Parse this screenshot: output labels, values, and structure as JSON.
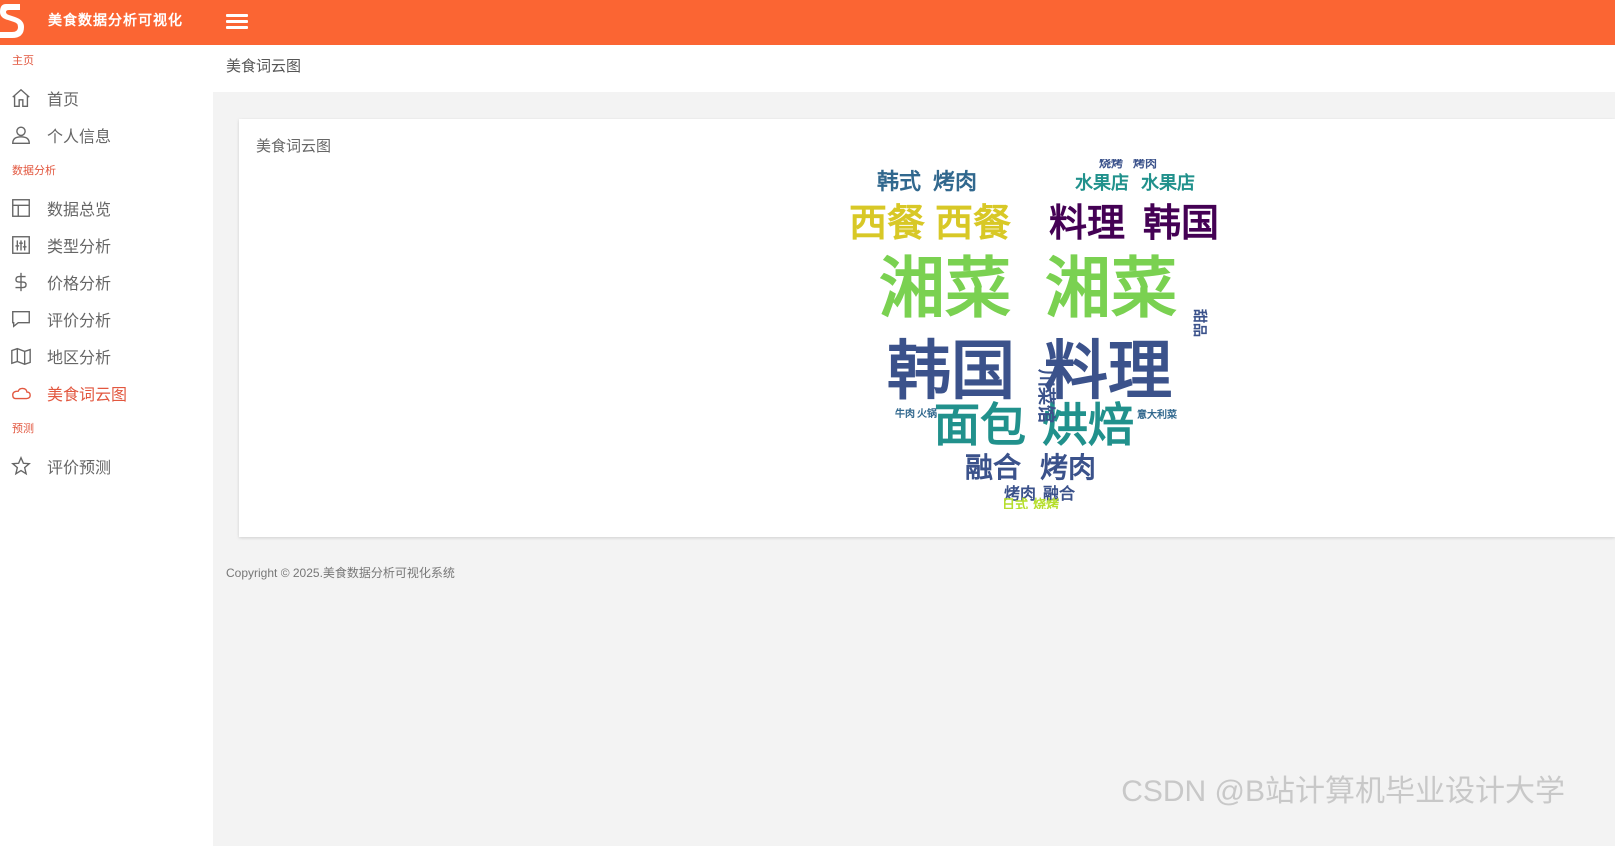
{
  "app": {
    "brand": "美食数据分析可视化",
    "accent": "#fb6533"
  },
  "sidebar": {
    "sections": {
      "main": "主页",
      "analysis": "数据分析",
      "predict": "预测"
    },
    "items": [
      {
        "label": "首页",
        "icon": "home-icon"
      },
      {
        "label": "个人信息",
        "icon": "user-icon"
      },
      {
        "label": "数据总览",
        "icon": "layout-icon"
      },
      {
        "label": "类型分析",
        "icon": "sliders-icon"
      },
      {
        "label": "价格分析",
        "icon": "dollar-icon"
      },
      {
        "label": "评价分析",
        "icon": "message-icon"
      },
      {
        "label": "地区分析",
        "icon": "map-icon"
      },
      {
        "label": "美食词云图",
        "icon": "cloud-icon",
        "active": true
      },
      {
        "label": "评价预测",
        "icon": "star-icon"
      }
    ]
  },
  "page": {
    "title": "美食词云图"
  },
  "card": {
    "title": "美食词云图"
  },
  "wordcloud": {
    "words": [
      "湘菜",
      "湘菜",
      "韩国",
      "料理",
      "面包",
      "烘焙",
      "料理",
      "韩国",
      "西餐",
      "西餐",
      "韩式",
      "烤肉",
      "水果店",
      "水果店",
      "融合",
      "烤肉",
      "川菜馆",
      "烤肉",
      "融合",
      "日式",
      "烧烤",
      "甜品",
      "牛肉",
      "火锅",
      "意大利菜",
      "烧烤",
      "烤肉"
    ]
  },
  "footer": {
    "text": "Copyright © 2025.美食数据分析可视化系统"
  },
  "watermark": {
    "text": "CSDN @B站计算机毕业设计大学"
  }
}
